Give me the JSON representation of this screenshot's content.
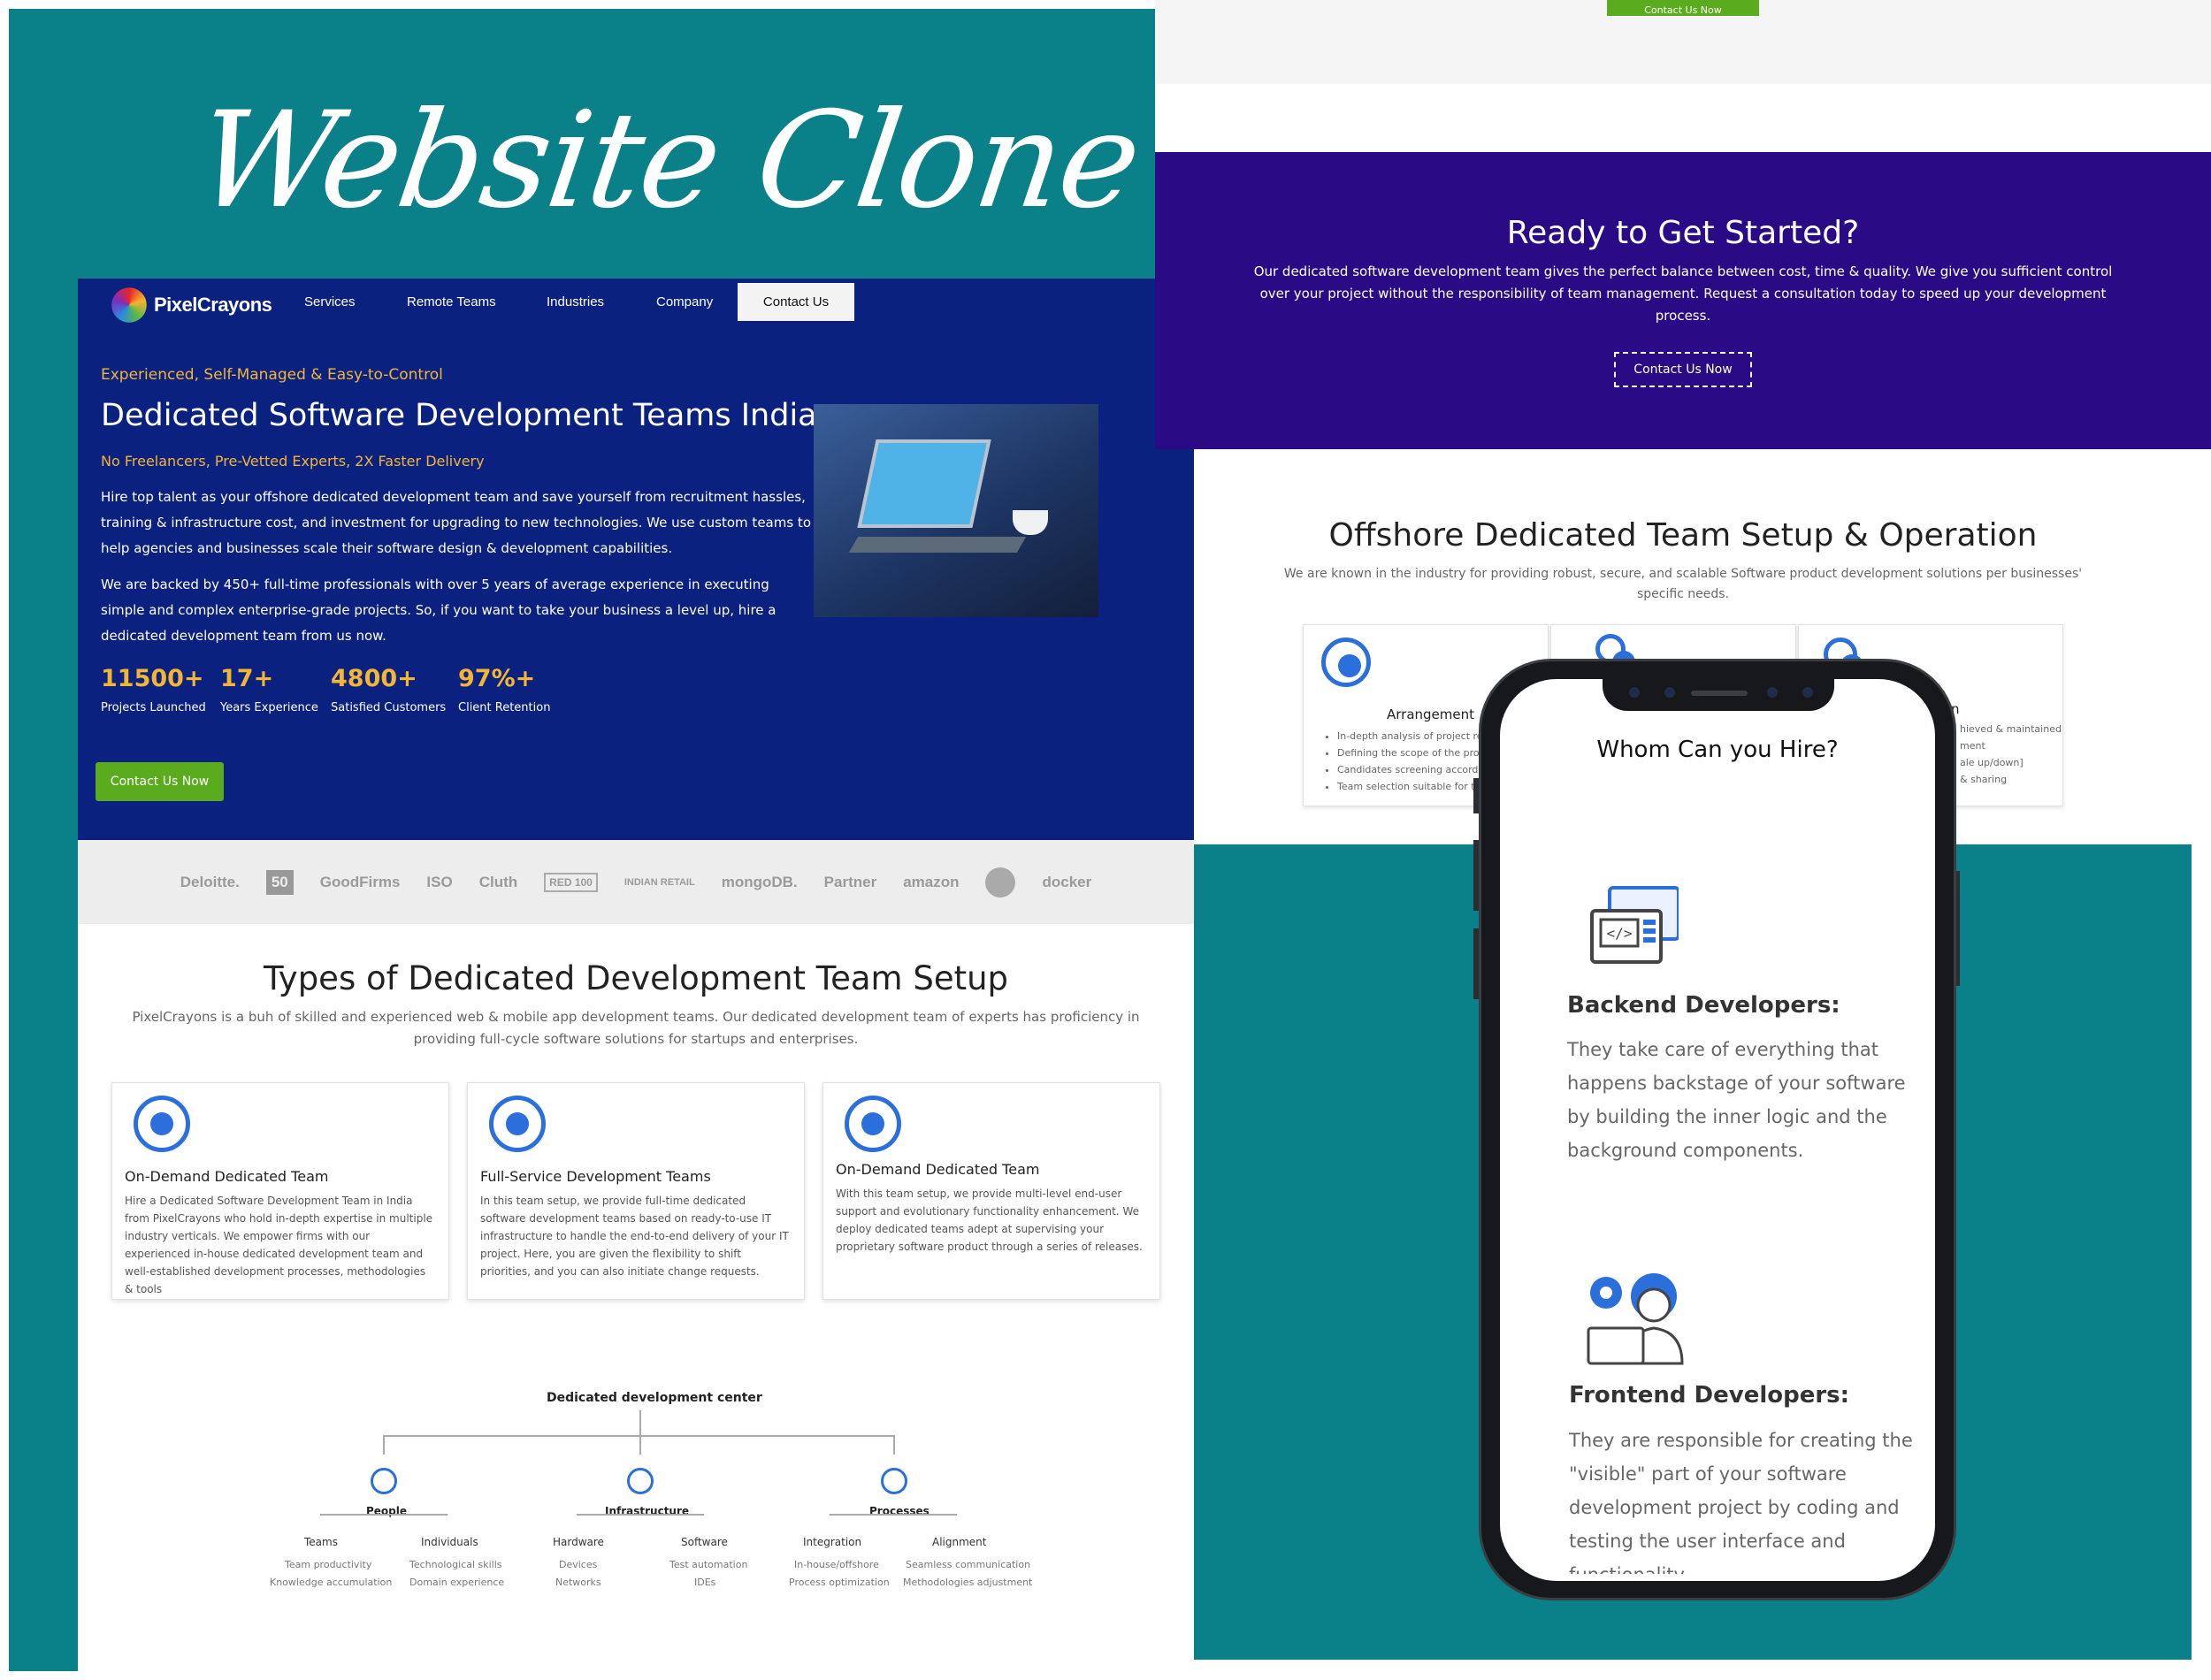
{
  "banner": {
    "title": "Website Clone"
  },
  "nav": {
    "logo_text": "PixelCrayons",
    "items": [
      "Services",
      "Remote Teams",
      "Industries",
      "Company"
    ],
    "contact_label": "Contact Us"
  },
  "hero": {
    "tagline": "Experienced, Self-Managed & Easy-to-Control",
    "title": "Dedicated Software Development Teams India",
    "subtag": "No Freelancers, Pre-Vetted Experts, 2X Faster Delivery",
    "para1": "Hire top talent as your offshore dedicated development team and save yourself from recruitment hassles, training & infrastructure cost, and investment for upgrading to new technologies. We use custom teams to help agencies and businesses scale their software design & development capabilities.",
    "para2": "We are backed by 450+ full-time professionals with over 5 years of average experience in executing simple and complex enterprise-grade projects. So, if you want to take your business a level up, hire a dedicated development team from us now.",
    "stats": [
      {
        "num": "11500+",
        "label": "Projects Launched"
      },
      {
        "num": "17+",
        "label": "Years Experience"
      },
      {
        "num": "4800+",
        "label": "Satisfied Customers"
      },
      {
        "num": "97%+",
        "label": "Client Retention"
      }
    ],
    "cta": "Contact Us Now"
  },
  "partners": [
    "Deloitte.",
    "50",
    "GoodFirms",
    "ISO",
    "Cluth",
    "RED 100",
    "INDIAN RETAIL",
    "mongoDB.",
    "Partner",
    "amazon",
    "",
    "docker"
  ],
  "types": {
    "title": "Types of Dedicated Development Team Setup",
    "subtitle": "PixelCrayons is a buh of skilled and experienced web & mobile app development teams. Our dedicated development team of experts has proficiency in providing full-cycle software solutions for startups and enterprises.",
    "cards": [
      {
        "title": "On-Demand Dedicated Team",
        "text": "Hire a Dedicated Software Development Team in India from PixelCrayons who hold in-depth expertise in multiple industry verticals. We empower firms with our experienced in-house dedicated development team and well-established development processes, methodologies & tools"
      },
      {
        "title": "Full-Service Development Teams",
        "text": "In this team setup, we provide full-time dedicated software development teams based on ready-to-use IT infrastructure to handle the end-to-end delivery of your IT project. Here, you are given the flexibility to shift priorities, and you can also initiate change requests."
      },
      {
        "title": "On-Demand Dedicated Team",
        "text": "With this team setup, we provide multi-level end-user support and evolutionary functionality enhancement. We deploy dedicated teams adept at supervising your proprietary software product through a series of releases."
      }
    ]
  },
  "org": {
    "root": "Dedicated development center",
    "groups": [
      {
        "name": "People",
        "subs": [
          {
            "name": "Teams",
            "leaves": [
              "Team productivity",
              "Knowledge accumulation"
            ]
          },
          {
            "name": "Individuals",
            "leaves": [
              "Technological skills",
              "Domain experience"
            ]
          }
        ]
      },
      {
        "name": "Infrastructure",
        "subs": [
          {
            "name": "Hardware",
            "leaves": [
              "Devices",
              "Networks"
            ]
          },
          {
            "name": "Software",
            "leaves": [
              "Test automation",
              "IDEs"
            ]
          }
        ]
      },
      {
        "name": "Processes",
        "subs": [
          {
            "name": "Integration",
            "leaves": [
              "In-house/offshore",
              "Process optimization"
            ]
          },
          {
            "name": "Alignment",
            "leaves": [
              "Seamless communication",
              "Methodologies adjustment"
            ]
          }
        ]
      }
    ]
  },
  "right_top": {
    "button": "Contact Us Now"
  },
  "ready": {
    "title": "Ready to Get Started?",
    "text": "Our dedicated software development team gives the perfect balance between cost, time & quality. We give you sufficient control over your project without the responsibility of team management. Request a consultation today to speed up your development process.",
    "cta": "Contact Us Now"
  },
  "offshore": {
    "title": "Offshore Dedicated Team Setup & Operation",
    "subtitle": "We are known in the industry for providing robust, secure, and scalable Software product development solutions per businesses' specific needs.",
    "card1": {
      "title": "Arrangement",
      "items": [
        "In-depth analysis of project re",
        "Defining the scope of the proje",
        "Candidates screening accordi",
        "Team selection suitable for th"
      ]
    },
    "card3": {
      "title": "n",
      "items": [
        "hieved & maintained",
        "ment",
        "ale up/down]",
        "& sharing"
      ]
    }
  },
  "phone": {
    "title": "Whom Can you Hire?",
    "roles": [
      {
        "title": "Backend Developers:",
        "text": "They take care of everything that happens backstage of your software by building the inner logic and the background components."
      },
      {
        "title": "Frontend Developers:",
        "text": "They are responsible for creating the \"visible\" part of your software development project by coding and testing the user interface and functionality."
      }
    ]
  },
  "colors": {
    "teal": "#0a8088",
    "hero_blue": "#0a2180",
    "ready_purple": "#2a0b85",
    "accent_yellow": "#f2b634",
    "cta_green": "#5aab1e",
    "icon_blue": "#2a6fdb"
  }
}
